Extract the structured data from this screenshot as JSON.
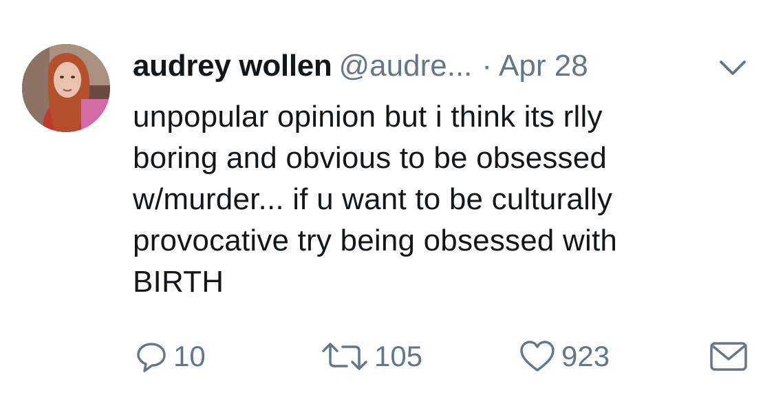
{
  "tweet": {
    "author": {
      "display_name": "audrey wollen",
      "handle": "@audre...",
      "separator": "·",
      "date": "Apr 28"
    },
    "menu_icon": "chevron-down-icon",
    "text": "unpopular opinion but i think its rlly\nboring and obvious to be obsessed\nw/murder... if u want to be culturally\nprovocative try being obsessed with\nBIRTH",
    "actions": {
      "reply": {
        "icon": "reply-icon",
        "count": "10"
      },
      "retweet": {
        "icon": "retweet-icon",
        "count": "105"
      },
      "like": {
        "icon": "heart-icon",
        "count": "923"
      },
      "message": {
        "icon": "envelope-icon"
      }
    }
  },
  "colors": {
    "text": "#14171a",
    "secondary": "#657786",
    "background": "#ffffff"
  }
}
